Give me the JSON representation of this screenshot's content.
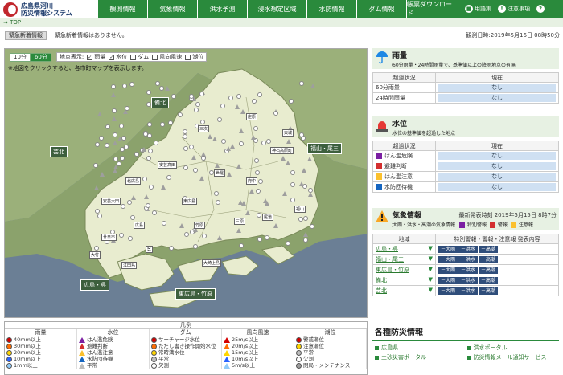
{
  "header": {
    "logo_line1": "広島県河川",
    "logo_line2": "防災情報システム",
    "nav": [
      "観測情報",
      "気象情報",
      "洪水予測",
      "浸水想定区域",
      "水防情報",
      "ダム情報",
      "帳票ダウンロード"
    ],
    "util": [
      {
        "icon": "book-icon",
        "label": "用語集"
      },
      {
        "icon": "exclaim-icon",
        "label": "注意事項"
      },
      {
        "icon": "help-icon",
        "label": ""
      }
    ]
  },
  "breadcrumb": "TOP",
  "alert": {
    "badge": "緊急新着情報",
    "text": "緊急新着情報はありません。",
    "observed": "観測日時:2019年5月16日 08時50分"
  },
  "map": {
    "interval_options": [
      "10分",
      "60分"
    ],
    "interval_selected": "60分",
    "display_label": "地点表示:",
    "layers": [
      {
        "label": "雨量",
        "checked": true
      },
      {
        "label": "水位",
        "checked": true
      },
      {
        "label": "ダム",
        "checked": false
      },
      {
        "label": "風向風速",
        "checked": false
      },
      {
        "label": "潮位",
        "checked": false
      }
    ],
    "hint": "※地図をクリックすると、各市町マップを表示します。",
    "regions": [
      "備北",
      "芸北",
      "福山・尾三",
      "広島・呉",
      "東広島・竹原"
    ],
    "towns": [
      "三次",
      "庄原",
      "東城",
      "府中",
      "世羅",
      "尾道",
      "福山",
      "三原",
      "竹原",
      "東広島",
      "広島",
      "呉",
      "江田島",
      "大崎上島",
      "廿日市",
      "大竹",
      "安芸高田",
      "北広島",
      "神石高原町",
      "安芸太田"
    ]
  },
  "rain": {
    "title": "雨量",
    "subtitle": "60分雨量・24時間雨量で、基準値以上の降雨地点の有無",
    "col_status": "超過状況",
    "col_now": "現在",
    "rows": [
      {
        "label": "60分雨量",
        "value": "なし"
      },
      {
        "label": "24時間雨量",
        "value": "なし"
      }
    ]
  },
  "water": {
    "title": "水位",
    "subtitle": "水位の基準値を超過した地点",
    "col_status": "超過状況",
    "col_now": "現在",
    "rows": [
      {
        "label": "はん濫危険",
        "value": "なし",
        "color": "#7b1fa2"
      },
      {
        "label": "避難判断",
        "value": "なし",
        "color": "#d32f2f"
      },
      {
        "label": "はん濫注意",
        "value": "なし",
        "color": "#fbc02d"
      },
      {
        "label": "水防団待機",
        "value": "なし",
        "color": "#1565c0"
      }
    ]
  },
  "weather": {
    "title": "気象情報",
    "issued_label": "最新発表時刻",
    "issued": "2019年5月15日 8時7分",
    "subtitle": "大雨・洪水・高潮の気象情報",
    "legend_special": "特別警報",
    "legend_warning": "警報",
    "legend_advisory": "注意報",
    "col_area": "地域",
    "col_status": "特別警報・警報・注意報 発表内容",
    "rows": [
      {
        "area": "広島・呉",
        "cells": [
          "－大雨",
          "－洪水",
          "－高潮"
        ]
      },
      {
        "area": "福山・尾三",
        "cells": [
          "－大雨",
          "－洪水",
          "－高潮"
        ]
      },
      {
        "area": "東広島・竹原",
        "cells": [
          "－大雨",
          "－洪水",
          "－高潮"
        ]
      },
      {
        "area": "備北",
        "cells": [
          "－大雨",
          "－洪水",
          "－高潮"
        ]
      },
      {
        "area": "芸北",
        "cells": [
          "－大雨",
          "－洪水",
          "－高潮"
        ]
      }
    ]
  },
  "legend": {
    "title": "凡例",
    "cols": [
      {
        "head": "雨量",
        "items": [
          "40mm以上",
          "30mm以上",
          "20mm以上",
          "10mm以上",
          "1mm以上"
        ],
        "colors": [
          "#d50000",
          "#ff6d00",
          "#ffd600",
          "#2962ff",
          "#90caf9"
        ]
      },
      {
        "head": "水位",
        "items": [
          "はん濫危険",
          "避難判断",
          "はん濫注意",
          "水防団待機",
          "平常"
        ],
        "colors": [
          "#7b1fa2",
          "#d32f2f",
          "#fbc02d",
          "#1565c0",
          "#bdbdbd"
        ]
      },
      {
        "head": "ダム",
        "items": [
          "サーチャージ水位",
          "ただし書き操作開始水位",
          "常時満水位",
          "平常",
          "欠測"
        ],
        "colors": [
          "#d50000",
          "#ff6d00",
          "#ffd600",
          "#bdbdbd",
          "#ffffff"
        ]
      },
      {
        "head": "風向風速",
        "items": [
          "25m/s以上",
          "20m/s以上",
          "15m/s以上",
          "10m/s以上",
          "5m/s以上"
        ],
        "colors": [
          "#d50000",
          "#ff6d00",
          "#ffd600",
          "#2962ff",
          "#90caf9"
        ]
      },
      {
        "head": "潮位",
        "items": [
          "警戒潮位",
          "注意潮位",
          "平常",
          "欠測",
          "閉局・メンテナンス"
        ],
        "colors": [
          "#d50000",
          "#ffd600",
          "#bdbdbd",
          "#ffffff",
          "#9e9e9e"
        ]
      }
    ]
  },
  "links": {
    "title": "各種防災情報",
    "items": [
      "広島県",
      "洪水ポータル",
      "土砂災害ポータル",
      "防災情報メール通知サービス"
    ]
  }
}
